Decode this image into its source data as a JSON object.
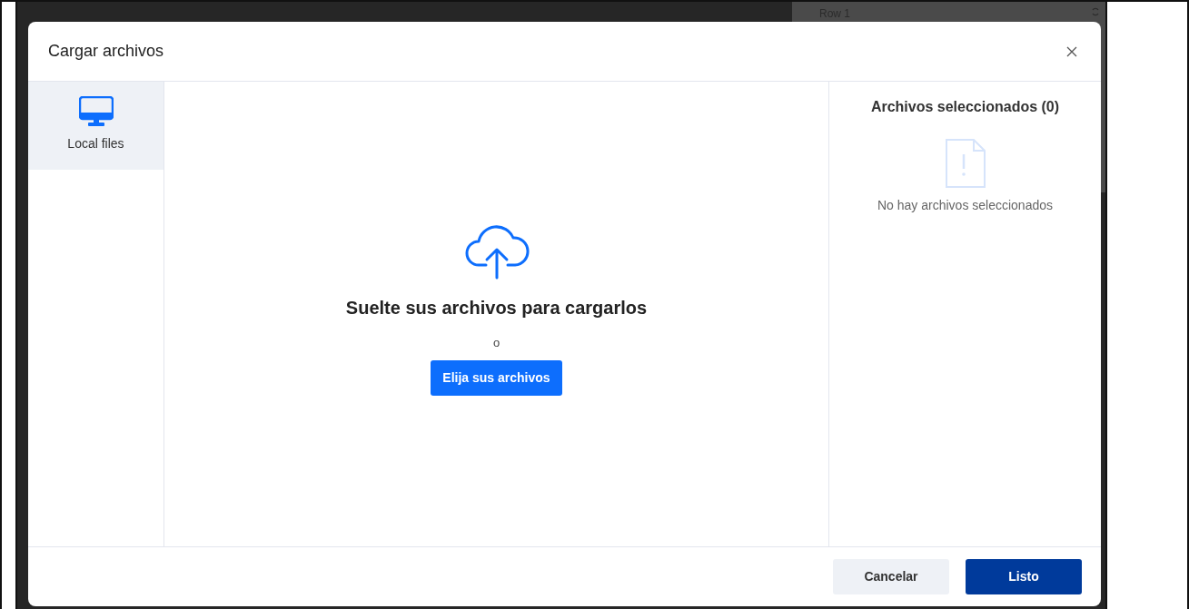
{
  "background": {
    "row_label": "Row 1"
  },
  "dialog": {
    "title": "Cargar archivos",
    "sources": [
      {
        "label": "Local files",
        "selected": true
      }
    ],
    "dropzone": {
      "heading": "Suelte sus archivos para cargarlos",
      "separator": "o",
      "button": "Elija sus archivos"
    },
    "selected_panel": {
      "title": "Archivos seleccionados (0)",
      "empty_message": "No hay archivos seleccionados"
    },
    "buttons": [
      {
        "label": "Cancelar",
        "kind": "secondary"
      },
      {
        "label": "Listo",
        "kind": "primary"
      }
    ]
  }
}
